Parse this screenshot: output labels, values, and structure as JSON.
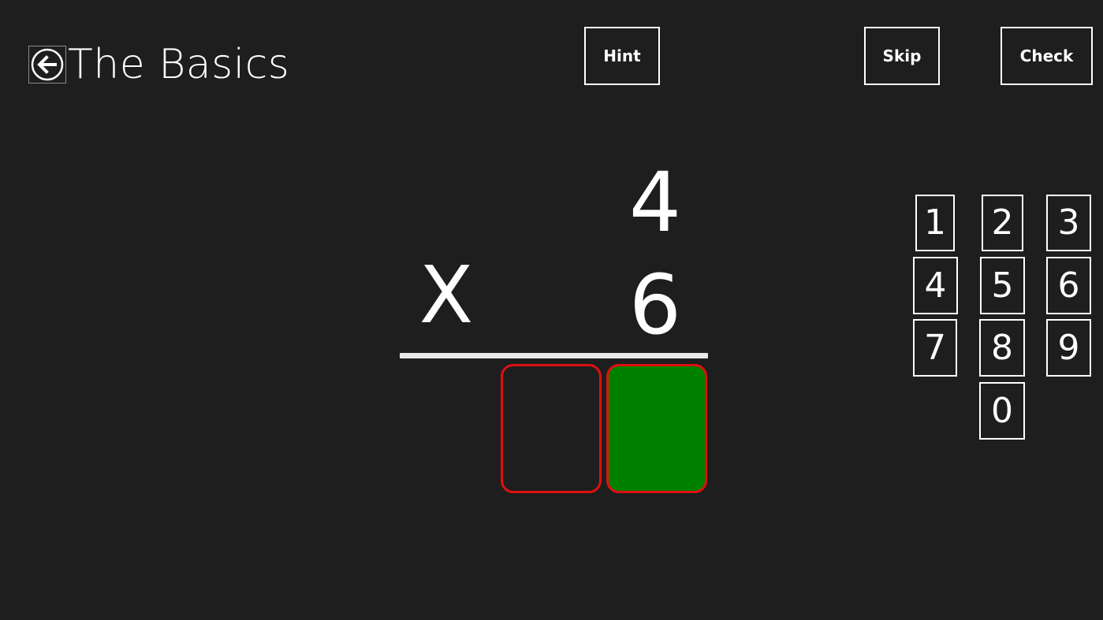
{
  "header": {
    "title": "The Basics",
    "back_icon": "back-arrow-icon",
    "hint_label": "Hint",
    "skip_label": "Skip",
    "check_label": "Check"
  },
  "problem": {
    "top_operand": "4",
    "operator": "X",
    "bottom_operand": "6",
    "answer_tens": "",
    "answer_ones": ""
  },
  "colors": {
    "background": "#1e1e1e",
    "answer_box_border": "#e01010",
    "active_answer_fill": "#008000"
  },
  "keypad": {
    "k1": "1",
    "k2": "2",
    "k3": "3",
    "k4": "4",
    "k5": "5",
    "k6": "6",
    "k7": "7",
    "k8": "8",
    "k9": "9",
    "k0": "0"
  }
}
